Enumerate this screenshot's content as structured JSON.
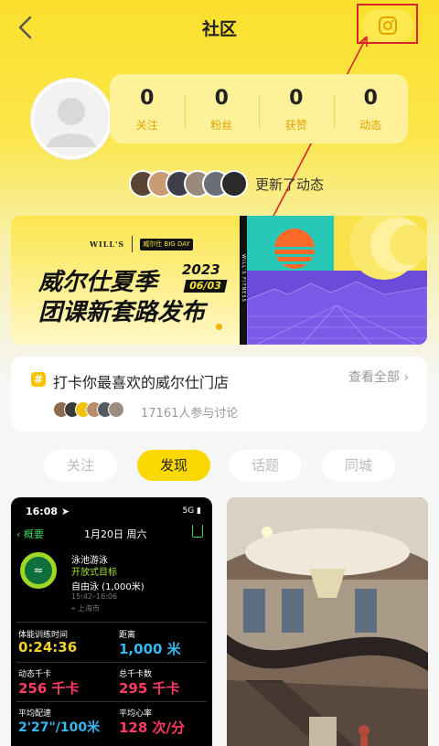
{
  "header": {
    "title": "社区",
    "back_icon": "chevron-left-icon",
    "camera_icon": "camera-icon"
  },
  "profile": {
    "avatar_icon": "default-avatar-icon",
    "stats": [
      {
        "value": "0",
        "label": "关注"
      },
      {
        "value": "0",
        "label": "粉丝"
      },
      {
        "value": "0",
        "label": "获赞"
      },
      {
        "value": "0",
        "label": "动态"
      }
    ]
  },
  "updates": {
    "text": "更新了动态"
  },
  "banner": {
    "brand": "WILL'S",
    "sub_brand": "威尔仕 BIG DAY",
    "line1": "威尔仕夏季",
    "year": "2023",
    "date": "06/03",
    "line2": "团课新套路发布",
    "side_text": "WILL'S FITNESS"
  },
  "topic": {
    "hash": "#",
    "title": "打卡你最喜欢的威尔仕门店",
    "see_all": "查看全部 ›",
    "count": "17161人参与讨论"
  },
  "tabs": [
    {
      "label": "关注",
      "active": false
    },
    {
      "label": "发现",
      "active": true
    },
    {
      "label": "话题",
      "active": false
    },
    {
      "label": "同城",
      "active": false
    }
  ],
  "post_left": {
    "time": "16:08 ➤",
    "status": "5G ▮",
    "back": "‹ 概要",
    "date": "1月20日 周六",
    "workout_name": "泳池游泳",
    "workout_goal": "开放式目标",
    "stroke": "自由泳 (1,000米)",
    "time_range": "15:42–16:06",
    "location": "⌖ 上海市",
    "metrics": [
      {
        "label": "体能训练时间",
        "value": "0:24:36",
        "color": "#f2d22b"
      },
      {
        "label": "距离",
        "value": "1,000 米",
        "color": "#35b7f0"
      },
      {
        "label": "动态千卡",
        "value": "256 千卡",
        "color": "#ff3b63"
      },
      {
        "label": "总千卡数",
        "value": "295 千卡",
        "color": "#ff3b63"
      },
      {
        "label": "平均配速",
        "value": "2'27\"/100米",
        "color": "#35b7f0"
      },
      {
        "label": "平均心率",
        "value": "128 次/分",
        "color": "#ff3b63"
      }
    ]
  }
}
